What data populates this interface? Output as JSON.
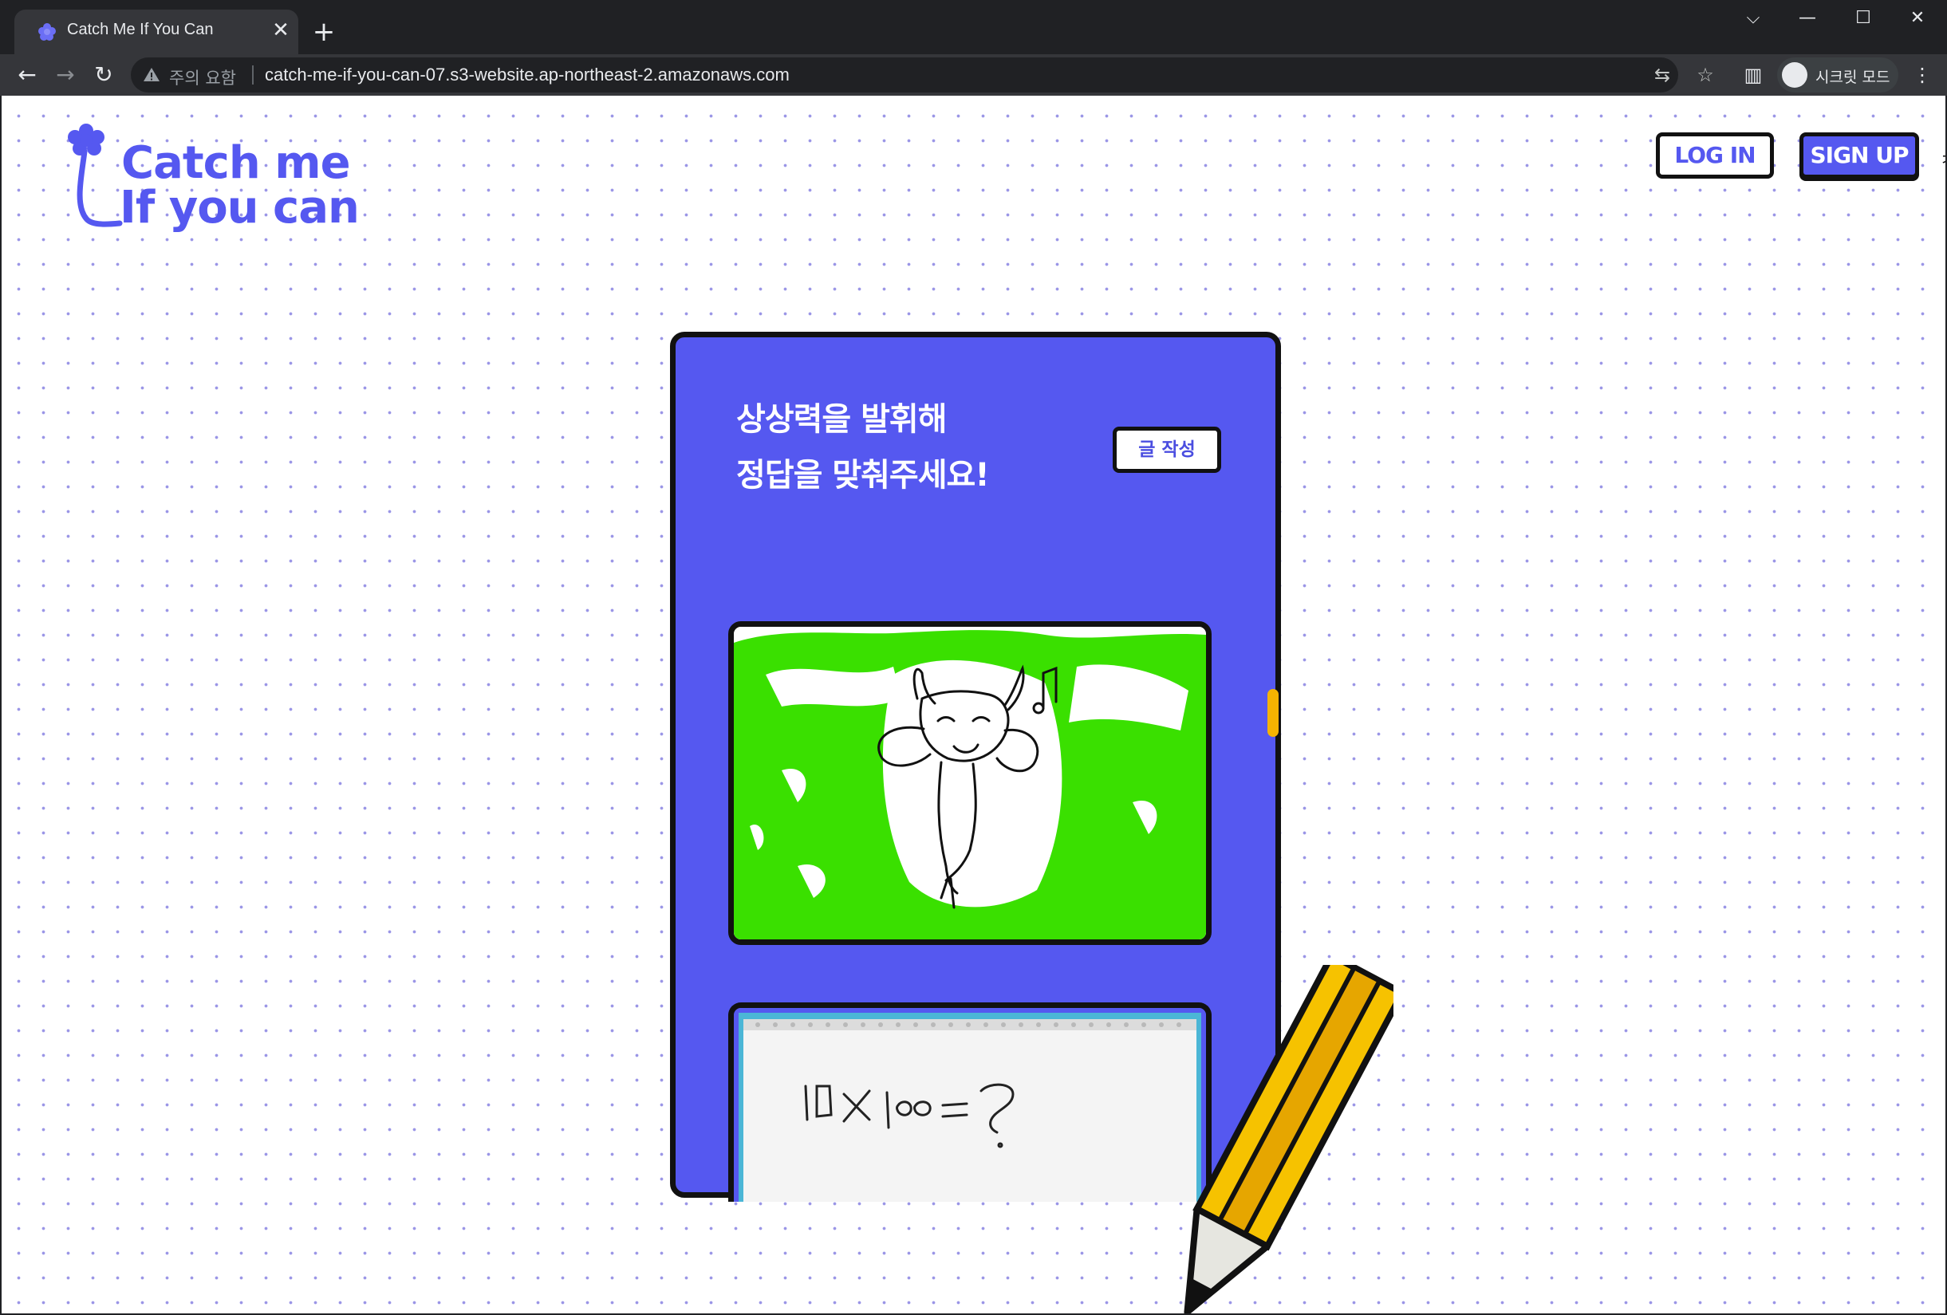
{
  "browser": {
    "tab_title": "Catch Me If You Can",
    "tab_close": "✕",
    "new_tab": "+",
    "window_controls": {
      "tab_search": "⌵",
      "minimize": "—",
      "maximize": "☐",
      "close": "✕"
    },
    "nav": {
      "back": "←",
      "forward": "→",
      "reload": "↻"
    },
    "security_label": "주의 요함",
    "url": "catch-me-if-you-can-07.s3-website.ap-northeast-2.amazonaws.com",
    "omnibox_icons": {
      "translate": "⇆",
      "bookmark": "☆"
    },
    "sidepanel_icon": "▥",
    "menu_icon": "⋮",
    "incognito_label": "시크릿 모드"
  },
  "header": {
    "logo_line1": "Catch me",
    "logo_line2": "If you can",
    "login_label": "LOG IN",
    "signup_label": "SIGN UP",
    "edge_glyph": "ㅊ"
  },
  "card": {
    "title_line1": "상상력을 발휘해",
    "title_line2": "정답을 맞춰주세요!",
    "write_button": "글 작성"
  },
  "quiz_image_1": {
    "description": "hand drawing: smiling figure with horns and music note on green scribble"
  },
  "quiz_image_2": {
    "handwriting": "10 X 100 = ?"
  },
  "colors": {
    "brand_purple": "#5558f0",
    "scroll_thumb": "#f5b301",
    "pencil_yellow": "#f6c200",
    "drawing_green": "#3ae000"
  }
}
